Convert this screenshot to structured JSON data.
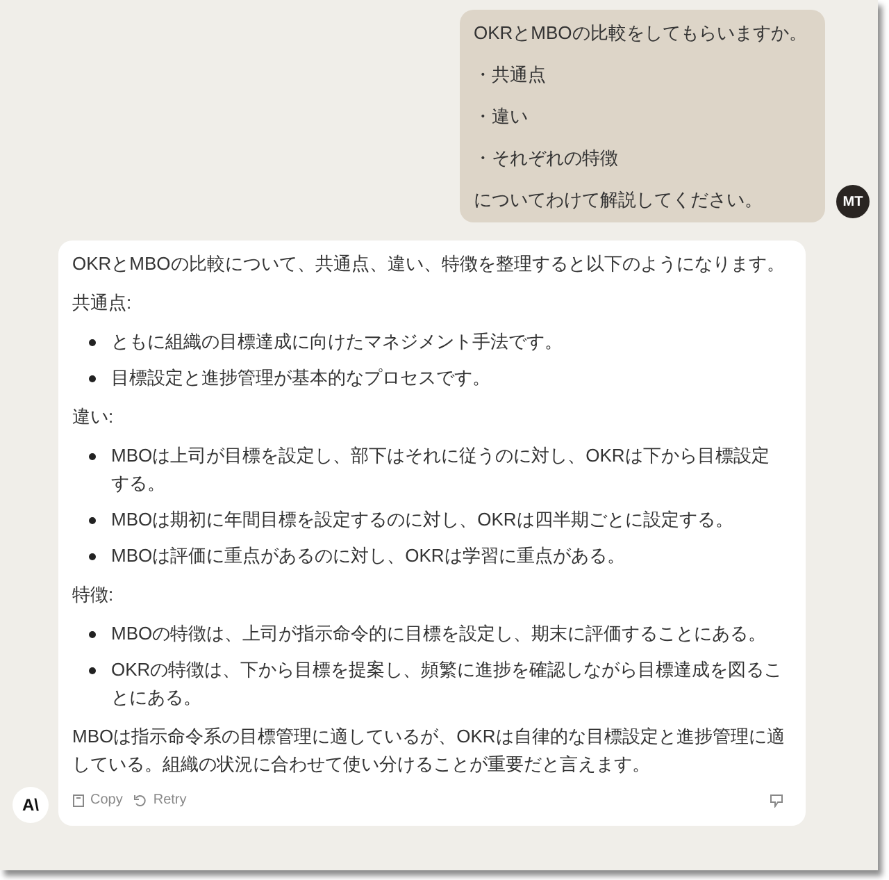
{
  "user_message": {
    "avatar": "MT",
    "lines": [
      "OKRとMBOの比較をしてもらいますか。",
      "・共通点",
      "・違い",
      "・それぞれの特徴",
      "についてわけて解説してください。"
    ]
  },
  "assistant_message": {
    "logo": "A\\",
    "blocks": [
      {
        "kind": "paragraph",
        "text": "OKRとMBOの比較について、共通点、違い、特徴を整理すると以下のようになります。"
      },
      {
        "kind": "paragraph",
        "text": "共通点:"
      },
      {
        "kind": "list",
        "items": [
          "ともに組織の目標達成に向けたマネジメント手法です。",
          "目標設定と進捗管理が基本的なプロセスです。"
        ]
      },
      {
        "kind": "paragraph",
        "text": "違い:"
      },
      {
        "kind": "list",
        "items": [
          "MBOは上司が目標を設定し、部下はそれに従うのに対し、OKRは下から目標設定する。",
          "MBOは期初に年間目標を設定するのに対し、OKRは四半期ごとに設定する。",
          "MBOは評価に重点があるのに対し、OKRは学習に重点がある。"
        ]
      },
      {
        "kind": "paragraph",
        "text": "特徴:"
      },
      {
        "kind": "list",
        "items": [
          "MBOの特徴は、上司が指示命令的に目標を設定し、期末に評価することにある。",
          "OKRの特徴は、下から目標を提案し、頻繁に進捗を確認しながら目標達成を図ることにある。"
        ]
      },
      {
        "kind": "paragraph",
        "text": "MBOは指示命令系の目標管理に適しているが、OKRは自律的な目標設定と進捗管理に適している。組織の状況に合わせて使い分けることが重要だと言えます。"
      }
    ],
    "actions": [
      "Copy",
      "Retry"
    ]
  }
}
